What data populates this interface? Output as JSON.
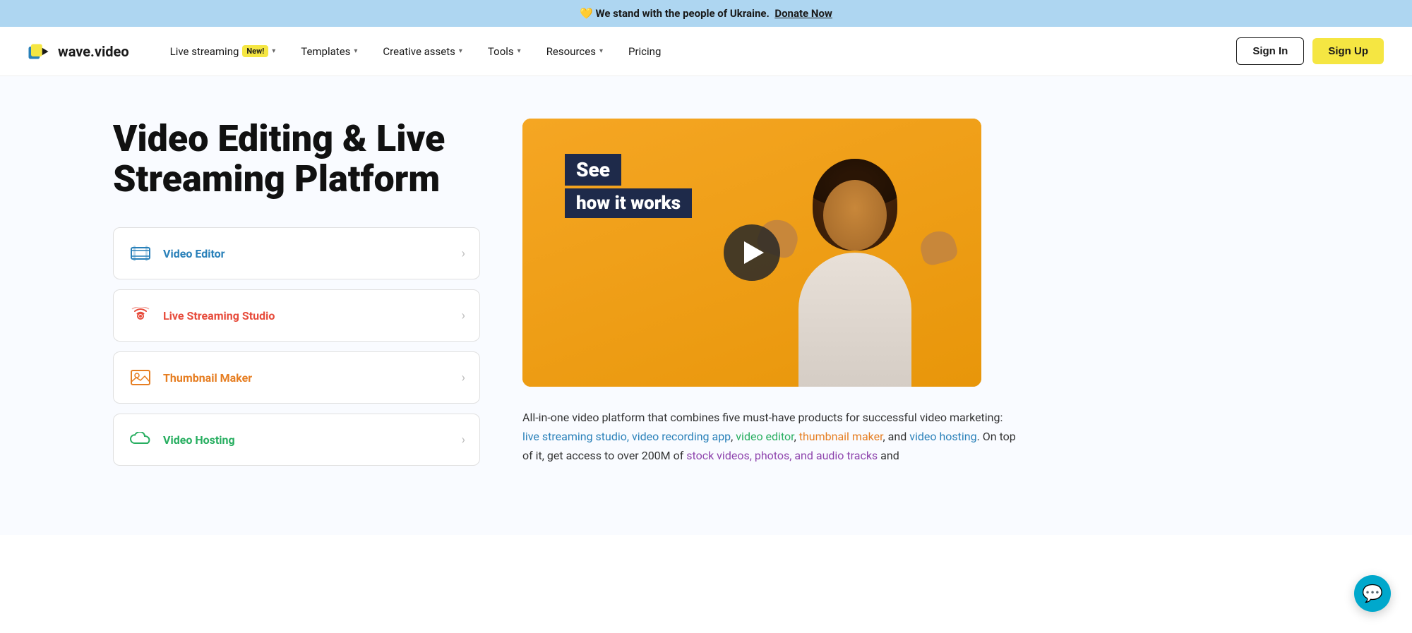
{
  "banner": {
    "heart": "💛",
    "text": "We stand with the people of Ukraine.",
    "donate_label": "Donate Now",
    "donate_url": "#"
  },
  "navbar": {
    "logo_text": "wave.video",
    "nav_items": [
      {
        "id": "live-streaming",
        "label": "Live streaming",
        "has_badge": true,
        "badge_text": "New!",
        "has_chevron": true
      },
      {
        "id": "templates",
        "label": "Templates",
        "has_badge": false,
        "has_chevron": true
      },
      {
        "id": "creative-assets",
        "label": "Creative assets",
        "has_badge": false,
        "has_chevron": true
      },
      {
        "id": "tools",
        "label": "Tools",
        "has_badge": false,
        "has_chevron": true
      },
      {
        "id": "resources",
        "label": "Resources",
        "has_badge": false,
        "has_chevron": true
      },
      {
        "id": "pricing",
        "label": "Pricing",
        "has_badge": false,
        "has_chevron": false
      }
    ],
    "signin_label": "Sign In",
    "signup_label": "Sign Up"
  },
  "hero": {
    "title": "Video Editing & Live Streaming Platform",
    "features": [
      {
        "id": "video-editor",
        "label": "Video Editor",
        "color": "blue",
        "icon": "film"
      },
      {
        "id": "live-streaming-studio",
        "label": "Live Streaming Studio",
        "color": "red",
        "icon": "live"
      },
      {
        "id": "thumbnail-maker",
        "label": "Thumbnail Maker",
        "color": "orange",
        "icon": "image"
      },
      {
        "id": "video-hosting",
        "label": "Video Hosting",
        "color": "green",
        "icon": "cloud"
      }
    ],
    "video_badge_line1": "See",
    "video_badge_line2": "how it works",
    "description": {
      "text_before": "All-in-one video platform that combines five must-have products for successful video marketing: ",
      "links": [
        {
          "text": "live streaming studio, video recording app",
          "color": "blue"
        },
        {
          "text": ", ",
          "color": "plain"
        },
        {
          "text": "video editor",
          "color": "green"
        },
        {
          "text": ", ",
          "color": "plain"
        },
        {
          "text": "thumbnail maker",
          "color": "orange"
        },
        {
          "text": ", and ",
          "color": "plain"
        },
        {
          "text": "video hosting",
          "color": "blue"
        }
      ],
      "text_after": ". On top of it, get access to over 200M of ",
      "stock_link": "stock videos, photos, and audio tracks",
      "text_end": " and"
    }
  },
  "chat": {
    "label": "chat-support"
  }
}
